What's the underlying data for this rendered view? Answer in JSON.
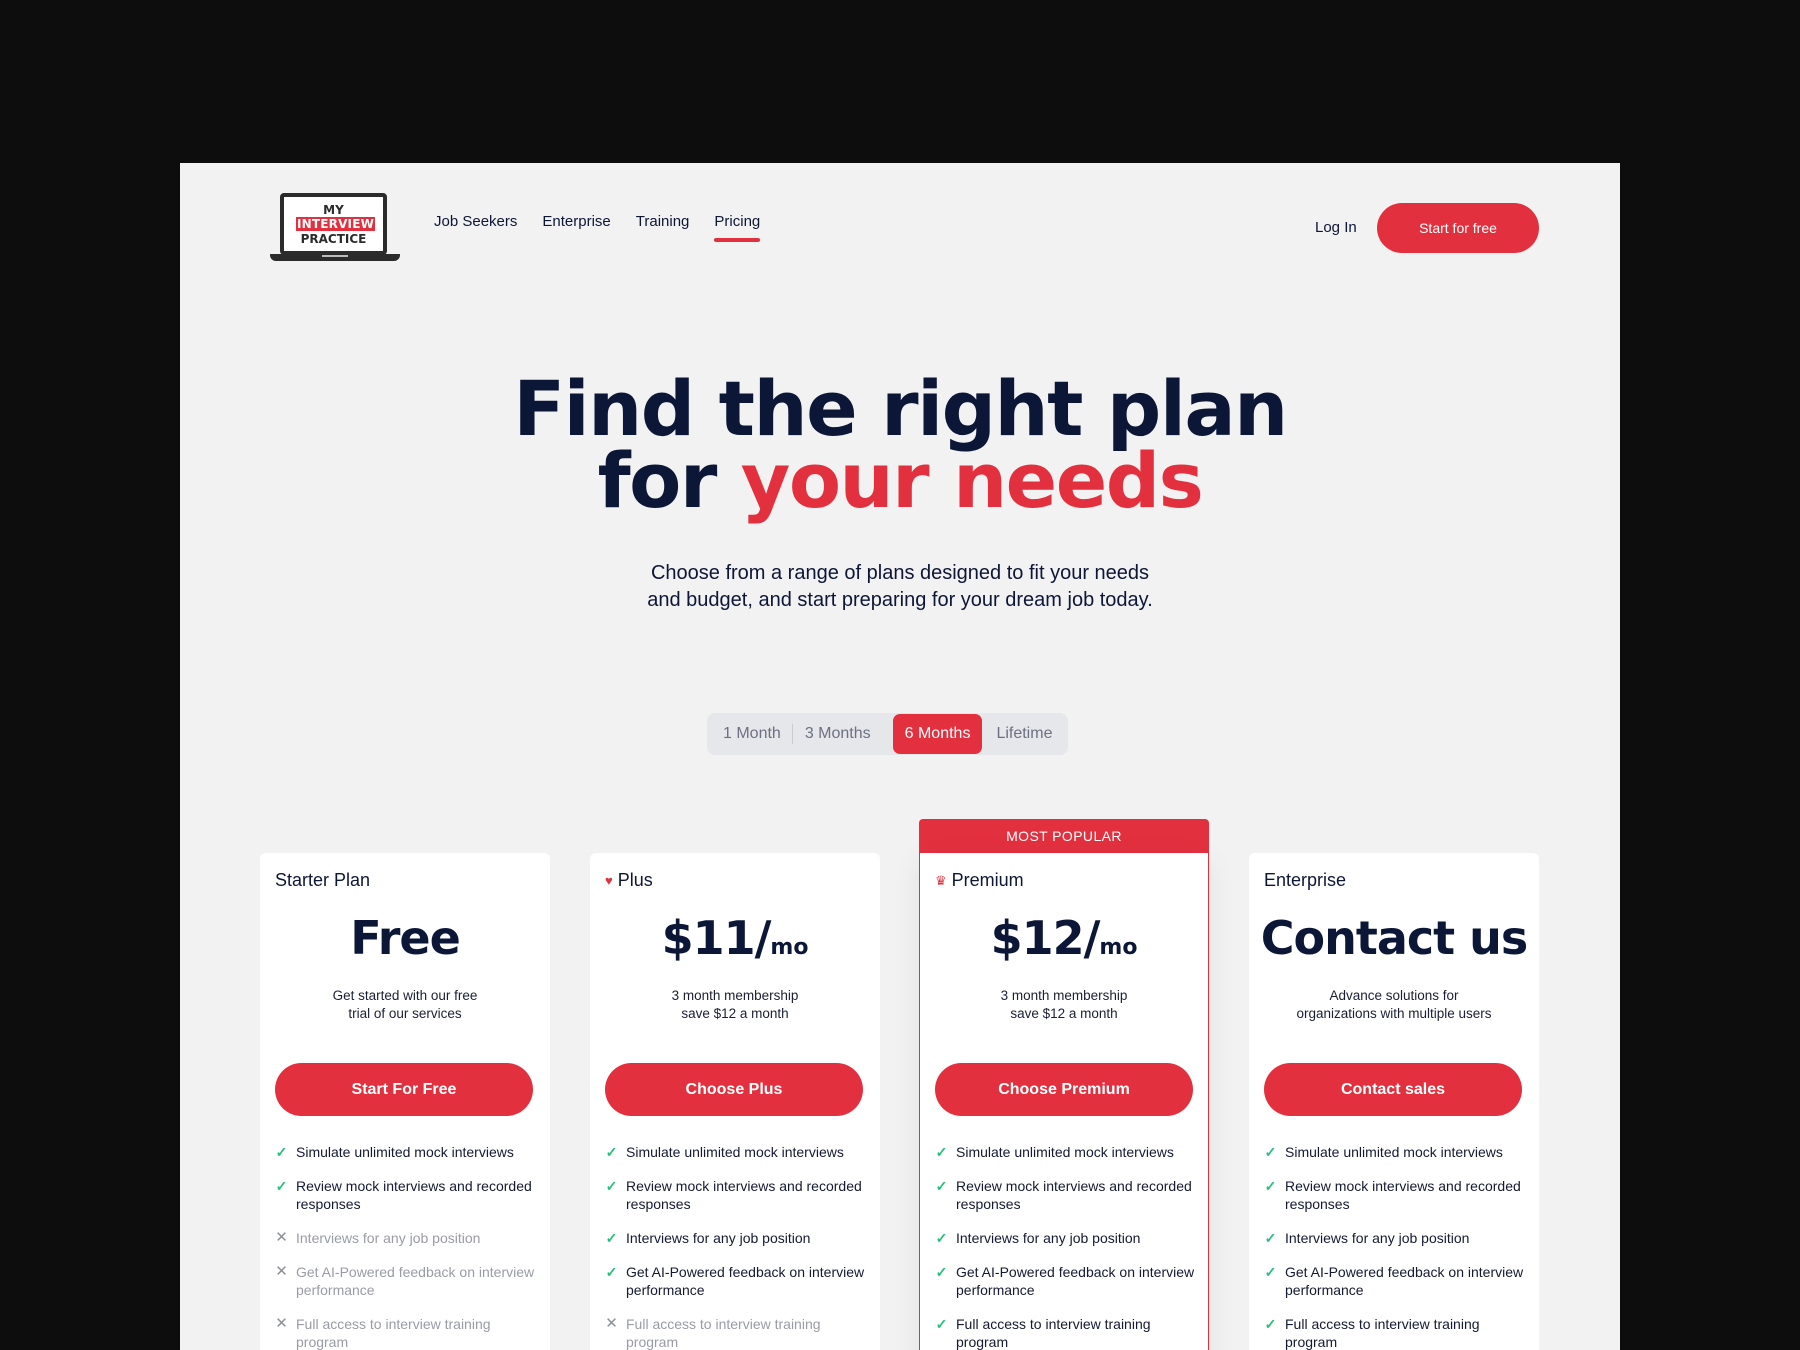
{
  "logo": {
    "line1": "MY",
    "line2": "INTERVIEW",
    "line3": "PRACTICE"
  },
  "nav": {
    "links": [
      "Job Seekers",
      "Enterprise",
      "Training",
      "Pricing"
    ],
    "active": "Pricing",
    "login_label": "Log In",
    "cta_label": "Start for free"
  },
  "hero": {
    "title_line1": "Find the right plan",
    "title_line2_prefix": "for ",
    "title_line2_accent": "your needs",
    "subtitle_line1": "Choose from a range of plans designed to fit your needs",
    "subtitle_line2": "and budget, and start preparing for your dream job today."
  },
  "billing_toggle": {
    "options": [
      "1 Month",
      "3 Months",
      "6 Months",
      "Lifetime"
    ],
    "selected": "6 Months"
  },
  "popular_banner": "MOST POPULAR",
  "plans": [
    {
      "name": "Starter Plan",
      "icon": "",
      "price": "Free",
      "per": "",
      "desc_line1": "Get started with our free",
      "desc_line2": "trial of our services",
      "button": "Start For Free",
      "features": [
        {
          "text": "Simulate unlimited mock interviews",
          "included": true
        },
        {
          "text": "Review mock interviews and recorded responses",
          "included": true
        },
        {
          "text": "Interviews for any job position",
          "included": false
        },
        {
          "text": "Get AI-Powered feedback on interview performance",
          "included": false
        },
        {
          "text": "Full access to interview training program",
          "included": false
        }
      ]
    },
    {
      "name": "Plus",
      "icon": "heart-icon",
      "price": "$11/",
      "per": "mo",
      "desc_line1": "3 month membership",
      "desc_line2": "save $12 a month",
      "button": "Choose Plus",
      "features": [
        {
          "text": "Simulate unlimited mock interviews",
          "included": true
        },
        {
          "text": "Review mock interviews and recorded responses",
          "included": true
        },
        {
          "text": "Interviews for any job position",
          "included": true
        },
        {
          "text": "Get AI-Powered feedback on interview performance",
          "included": true
        },
        {
          "text": "Full access to interview training program",
          "included": false
        }
      ]
    },
    {
      "name": "Premium",
      "icon": "crown-icon",
      "price": "$12/",
      "per": "mo",
      "desc_line1": "3 month membership",
      "desc_line2": "save $12 a month",
      "button": "Choose Premium",
      "features": [
        {
          "text": "Simulate unlimited mock interviews",
          "included": true
        },
        {
          "text": "Review mock interviews and recorded responses",
          "included": true
        },
        {
          "text": "Interviews for any job position",
          "included": true
        },
        {
          "text": "Get AI-Powered feedback on interview performance",
          "included": true
        },
        {
          "text": "Full access to interview training program",
          "included": true
        }
      ]
    },
    {
      "name": "Enterprise",
      "icon": "",
      "price": "Contact us",
      "per": "",
      "desc_line1": "Advance solutions for",
      "desc_line2": "organizations with multiple users",
      "button": "Contact sales",
      "features": [
        {
          "text": "Simulate unlimited mock interviews",
          "included": true
        },
        {
          "text": "Review mock interviews and recorded responses",
          "included": true
        },
        {
          "text": "Interviews for any job position",
          "included": true
        },
        {
          "text": "Get AI-Powered feedback on interview performance",
          "included": true
        },
        {
          "text": "Full access to interview training program",
          "included": true
        }
      ]
    }
  ],
  "colors": {
    "accent": "#e3303f",
    "navy": "#0c1738",
    "check": "#27c07a",
    "page_bg": "#f2f2f2"
  }
}
